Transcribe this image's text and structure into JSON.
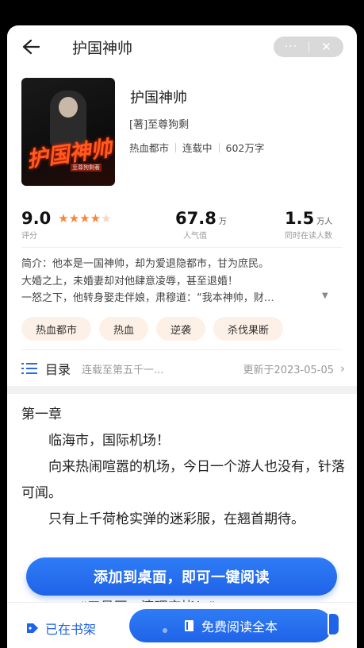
{
  "header": {
    "title": "护国神帅",
    "more_label": "···",
    "close_label": "✕"
  },
  "book": {
    "cover_title": "护国神帅",
    "cover_subtitle": "至尊狗剩著",
    "title": "护国神帅",
    "author": "[著]至尊狗剩",
    "genre": "热血都市",
    "status": "连载中",
    "word_count": "602万字"
  },
  "stats": {
    "score": "9.0",
    "stars_filled": 4,
    "stars_total": 5,
    "score_label": "评分",
    "popularity": "67.8",
    "popularity_unit": "万",
    "popularity_label": "人气值",
    "readers": "1.5",
    "readers_unit": "万人",
    "readers_label": "同时在读人数"
  },
  "intro": {
    "line1": "简介：他本是一国神帅，却为爱退隐都市，甘为庶民。",
    "line2": "大婚之上，未婚妻却对他肆意凌辱，甚至退婚！",
    "line3": "一怒之下，他转身娶走伴娘，肃穆道：“我本神帅，财…"
  },
  "tags": [
    "热血都市",
    "热血",
    "逆袭",
    "杀伐果断"
  ],
  "catalog": {
    "label": "目录",
    "latest": "连载至第五千一...",
    "updated": "更新于2023-05-05",
    "arrow": "›"
  },
  "chapter": {
    "title": "第一章",
    "p1": "临海市，国际机场！",
    "p2": "向来热闹喧嚣的机场，今日一个游人也没有，针落可闻。",
    "p3": "只有上千荷枪实弹的迷彩服，在翘首期待。",
    "p4": "“三号区，清理完毕！”"
  },
  "add_desktop": {
    "label": "添加到桌面，即可一键阅读"
  },
  "bottom": {
    "shelf_label": "已在书架",
    "read_label": "免费阅读全本"
  },
  "colors": {
    "accent": "#1f63e8",
    "star": "#f5883a",
    "tag_bg": "#fdf1e7"
  }
}
